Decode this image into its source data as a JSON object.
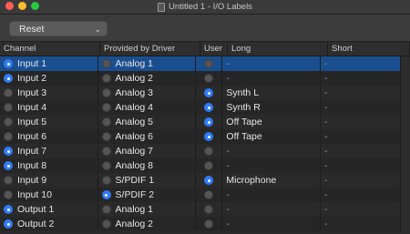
{
  "window": {
    "title": "Untitled 1 - I/O Labels",
    "lights": [
      "close-button",
      "minimize-button",
      "zoom-button"
    ]
  },
  "toolbar": {
    "reset_label": "Reset"
  },
  "table": {
    "columns": [
      "Channel",
      "Provided by Driver",
      "User",
      "Long",
      "Short"
    ],
    "rows": [
      {
        "channel": "Input 1",
        "channel_on": true,
        "driver": "Analog 1",
        "driver_on": false,
        "user_on": false,
        "long": "-",
        "short": "-",
        "selected": true
      },
      {
        "channel": "Input 2",
        "channel_on": true,
        "driver": "Analog 2",
        "driver_on": false,
        "user_on": false,
        "long": "-",
        "short": "-"
      },
      {
        "channel": "Input 3",
        "channel_on": false,
        "driver": "Analog 3",
        "driver_on": false,
        "user_on": true,
        "long": "Synth L",
        "short": "-"
      },
      {
        "channel": "Input 4",
        "channel_on": false,
        "driver": "Analog 4",
        "driver_on": false,
        "user_on": true,
        "long": "Synth R",
        "short": "-"
      },
      {
        "channel": "Input 5",
        "channel_on": false,
        "driver": "Analog 5",
        "driver_on": false,
        "user_on": true,
        "long": "Off Tape",
        "short": "-"
      },
      {
        "channel": "Input 6",
        "channel_on": false,
        "driver": "Analog 6",
        "driver_on": false,
        "user_on": true,
        "long": "Off Tape",
        "short": "-"
      },
      {
        "channel": "Input 7",
        "channel_on": true,
        "driver": "Analog 7",
        "driver_on": false,
        "user_on": false,
        "long": "-",
        "short": "-"
      },
      {
        "channel": "Input 8",
        "channel_on": true,
        "driver": "Analog 8",
        "driver_on": false,
        "user_on": false,
        "long": "-",
        "short": "-"
      },
      {
        "channel": "Input 9",
        "channel_on": false,
        "driver": "S/PDIF 1",
        "driver_on": false,
        "user_on": true,
        "long": "Microphone",
        "short": "-"
      },
      {
        "channel": "Input 10",
        "channel_on": false,
        "driver": "S/PDIF 2",
        "driver_on": true,
        "user_on": false,
        "long": "-",
        "short": "-"
      },
      {
        "channel": "Output 1",
        "channel_on": true,
        "driver": "Analog 1",
        "driver_on": false,
        "user_on": false,
        "long": "-",
        "short": "-"
      },
      {
        "channel": "Output 2",
        "channel_on": true,
        "driver": "Analog 2",
        "driver_on": false,
        "user_on": false,
        "long": "-",
        "short": "-"
      }
    ]
  },
  "colors": {
    "accent": "#2f7cf6",
    "selection": "#1a4f8f",
    "background": "#2b2b2b"
  }
}
